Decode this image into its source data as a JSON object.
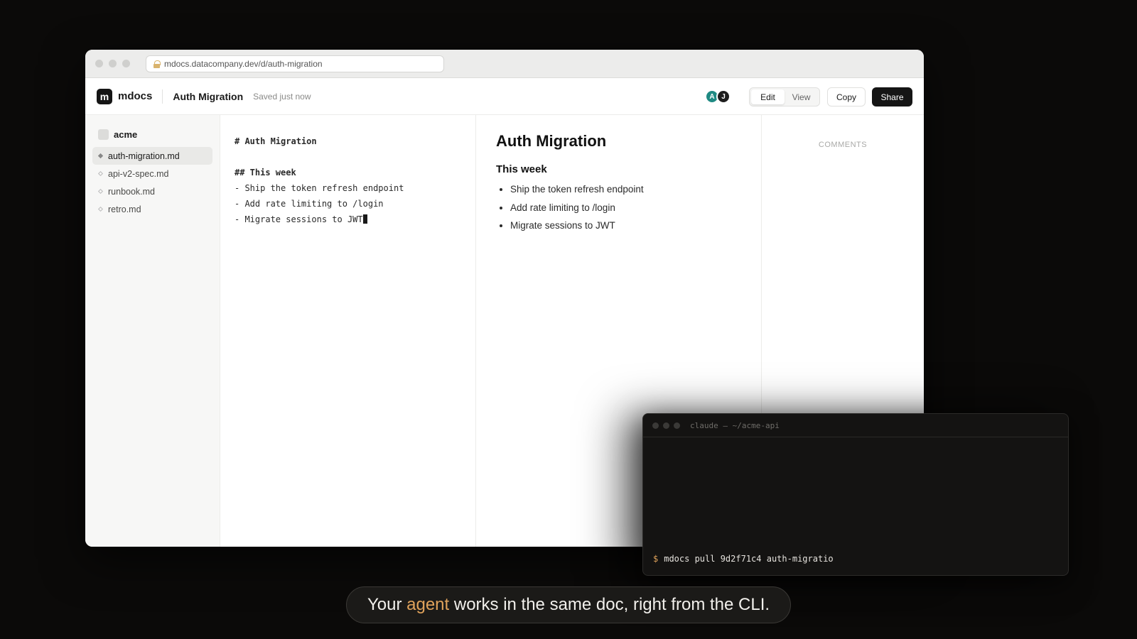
{
  "browser": {
    "url": "mdocs.datacompany.dev/d/auth-migration"
  },
  "header": {
    "logo_letter": "m",
    "brand": "mdocs",
    "doc_title": "Auth Migration",
    "status": "Saved just now",
    "avatars": [
      {
        "initial": "A",
        "color": "#1f8a83"
      },
      {
        "initial": "J",
        "color": "#1d1d1d"
      }
    ],
    "mode_edit": "Edit",
    "mode_view": "View",
    "copy_label": "Copy",
    "share_label": "Share"
  },
  "sidebar": {
    "workspace": "acme",
    "files": [
      {
        "name": "auth-migration.md",
        "active": true
      },
      {
        "name": "api-v2-spec.md",
        "active": false
      },
      {
        "name": "runbook.md",
        "active": false
      },
      {
        "name": "retro.md",
        "active": false
      }
    ]
  },
  "editor": {
    "lines": [
      "# Auth Migration",
      "",
      "## This week",
      "- Ship the token refresh endpoint",
      "- Add rate limiting to /login",
      "- Migrate sessions to JWT"
    ]
  },
  "preview": {
    "h1": "Auth Migration",
    "h2": "This week",
    "items": [
      "Ship the token refresh endpoint",
      "Add rate limiting to /login",
      "Migrate sessions to JWT"
    ]
  },
  "comments": {
    "title": "COMMENTS"
  },
  "terminal": {
    "title": "claude — ~/acme-api",
    "prompt": "$",
    "command": "mdocs pull 9d2f71c4 auth-migratio"
  },
  "caption": {
    "before": "Your ",
    "accent": "agent",
    "after": " works in the same doc, right from the CLI.",
    "accent_color": "#e0a25b"
  }
}
